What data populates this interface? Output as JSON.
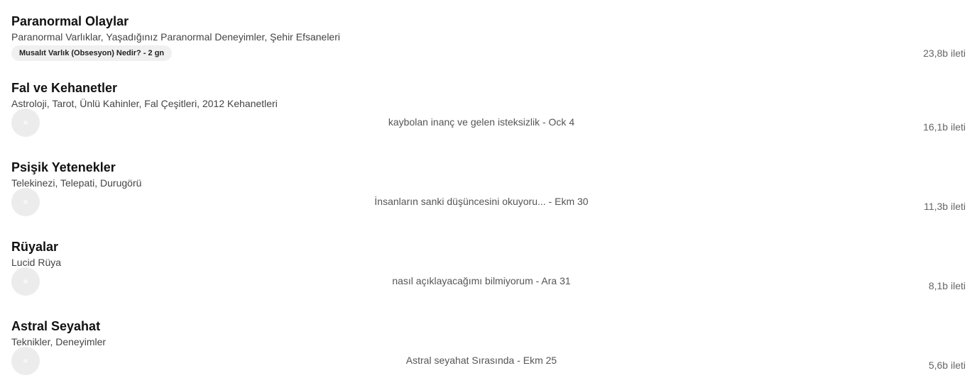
{
  "forums": [
    {
      "title": "Paranormal Olaylar",
      "description": "Paranormal Varlıklar, Yaşadığınız Paranormal Deneyimler, Şehir Efsaneleri",
      "latest_tag": "Musalıt Varlık (Obsesyon) Nedir? - 2 gn",
      "post_count": "23,8b ileti"
    },
    {
      "title": "Fal ve Kehanetler",
      "description": "Astroloji, Tarot, Ünlü Kahinler, Fal Çeşitleri, 2012 Kehanetleri",
      "last_post": "kaybolan inanç ve gelen isteksizlik - Ock 4",
      "post_count": "16,1b ileti"
    },
    {
      "title": "Psişik Yetenekler",
      "description": "Telekinezi, Telepati, Durugörü",
      "last_post": "İnsanların sanki düşüncesini okuyoru... - Ekm 30",
      "post_count": "11,3b ileti"
    },
    {
      "title": "Rüyalar",
      "description": "Lucid Rüya",
      "last_post": "nasıl açıklayacağımı bilmiyorum - Ara 31",
      "post_count": "8,1b ileti"
    },
    {
      "title": "Astral Seyahat",
      "description": "Teknikler, Deneyimler",
      "last_post": "Astral seyahat Sırasında - Ekm 25",
      "post_count": "5,6b ileti"
    }
  ]
}
